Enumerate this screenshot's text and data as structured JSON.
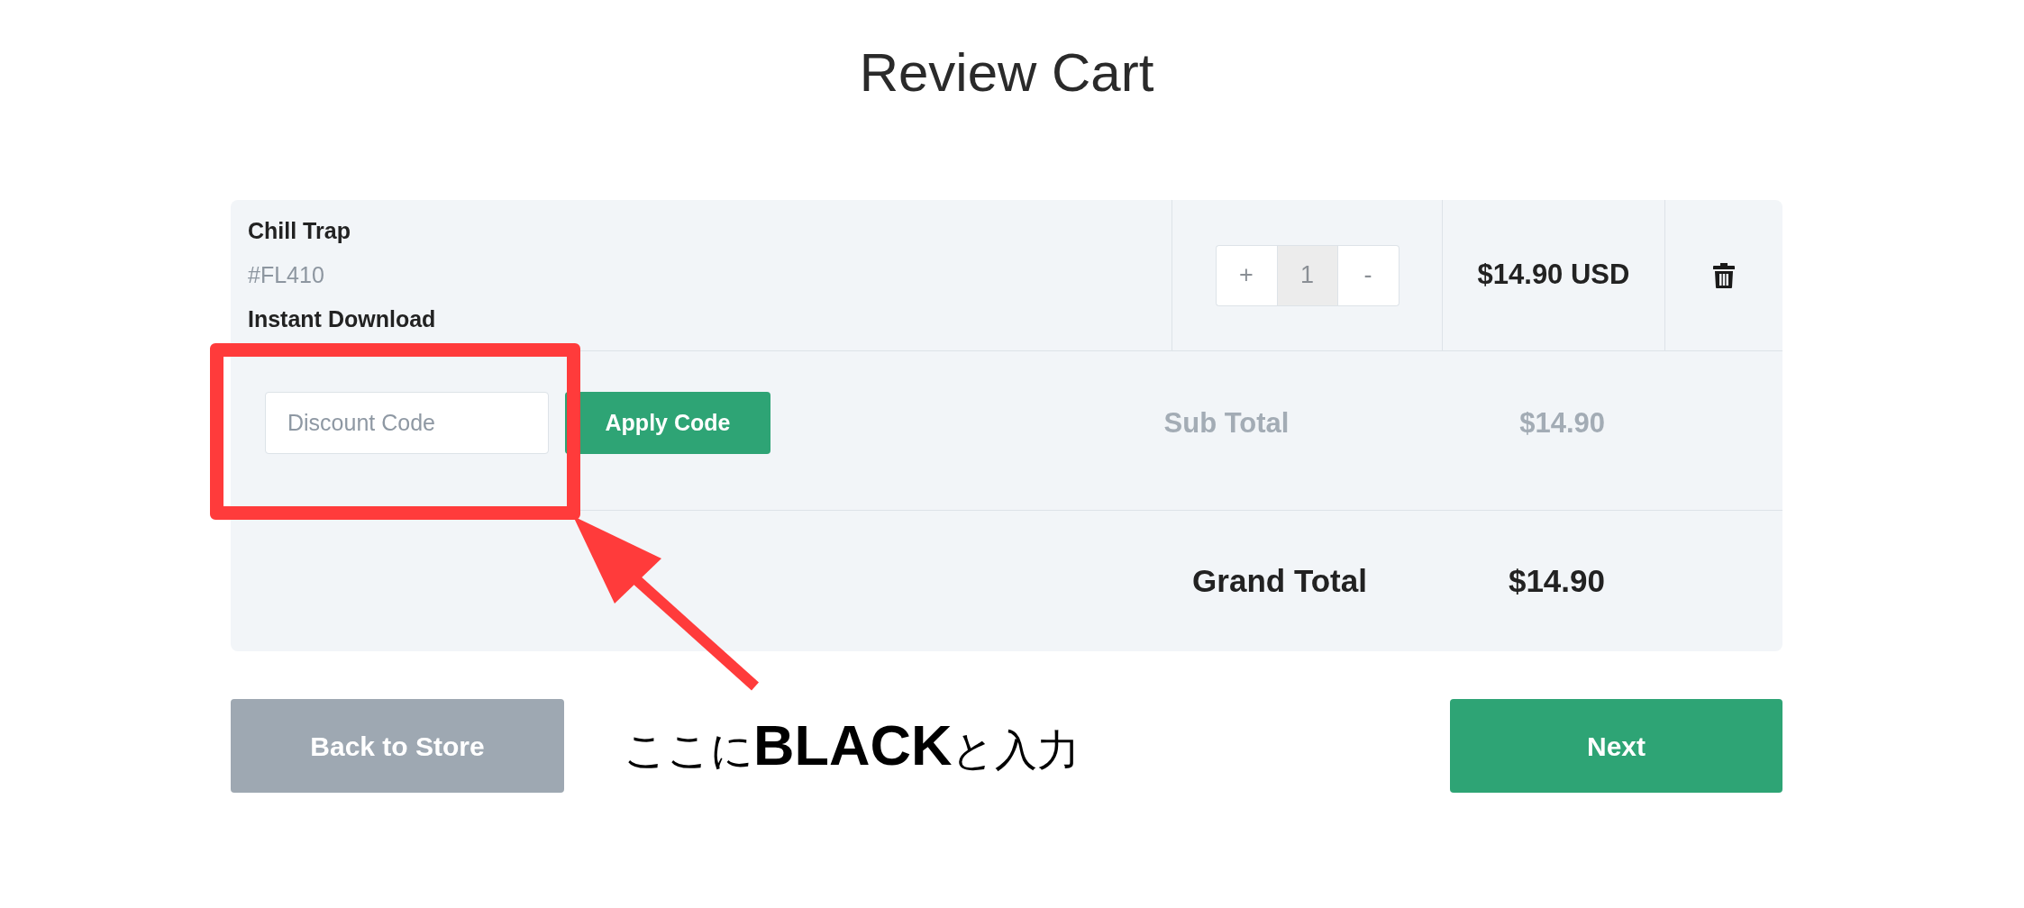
{
  "title": "Review Cart",
  "cart": {
    "items": [
      {
        "name": "Chill Trap",
        "sku": "#FL410",
        "delivery": "Instant Download",
        "quantity": {
          "increase": "+",
          "value": "1",
          "decrease": "-"
        },
        "price": "$14.90 USD"
      }
    ],
    "discount": {
      "placeholder": "Discount Code",
      "button": "Apply Code"
    },
    "subtotal": {
      "label": "Sub Total",
      "value": "$14.90"
    },
    "grand_total": {
      "label": "Grand Total",
      "value": "$14.90"
    }
  },
  "back_button": "Back to Store",
  "annotation": {
    "text": "ここに**BLACK**と入力"
  },
  "next_button": "Next"
}
